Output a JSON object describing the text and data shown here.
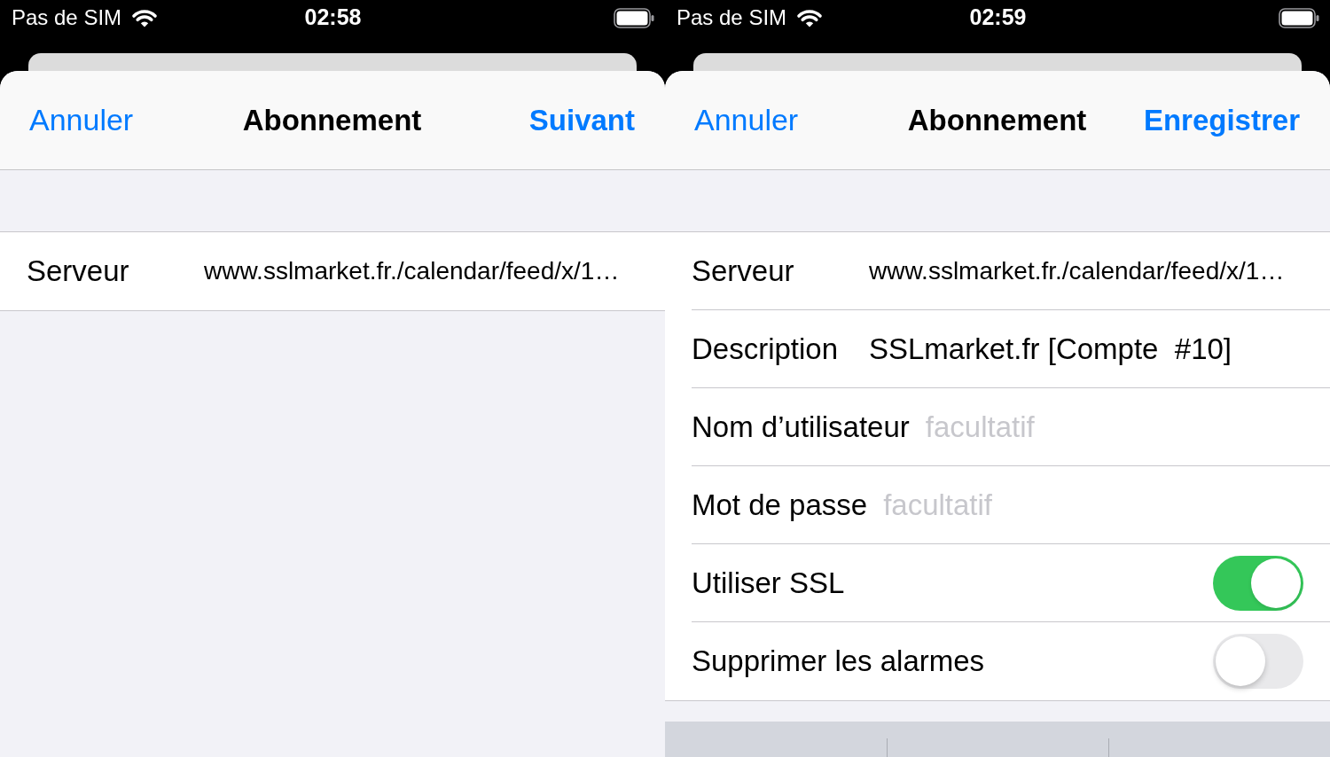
{
  "screens": [
    {
      "status_bar": {
        "carrier": "Pas de SIM",
        "time": "02:58"
      },
      "nav_bar": {
        "cancel": "Annuler",
        "title": "Abonnement",
        "action": "Suivant"
      },
      "fields": [
        {
          "kind": "url",
          "label": "Serveur",
          "value": "www.sslmarket.fr./calendar/feed/x/1…"
        }
      ],
      "keyboard_shown": false
    },
    {
      "status_bar": {
        "carrier": "Pas de SIM",
        "time": "02:59"
      },
      "nav_bar": {
        "cancel": "Annuler",
        "title": "Abonnement",
        "action": "Enregistrer"
      },
      "fields": [
        {
          "kind": "url",
          "label": "Serveur",
          "value": "www.sslmarket.fr./calendar/feed/x/1…"
        },
        {
          "kind": "text",
          "label": "Description",
          "value": "SSLmarket.fr [Compte  #10]"
        },
        {
          "kind": "text",
          "label": "Nom d’utilisateur",
          "placeholder": "facultatif"
        },
        {
          "kind": "text",
          "label": "Mot de passe",
          "placeholder": "facultatif"
        },
        {
          "kind": "switch",
          "label": "Utiliser SSL",
          "on": true
        },
        {
          "kind": "switch",
          "label": "Supprimer les alarmes",
          "on": false
        }
      ],
      "keyboard_shown": true
    }
  ]
}
